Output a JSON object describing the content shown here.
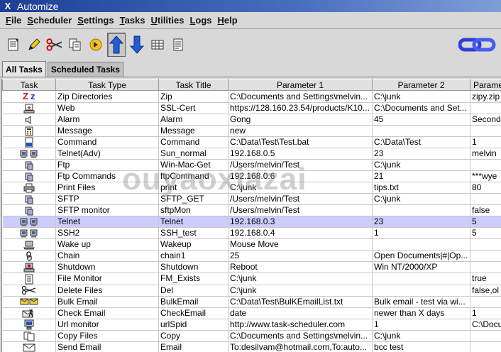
{
  "window": {
    "title": "Automize"
  },
  "menu": [
    {
      "label": "File",
      "key": "F",
      "rest": "ile"
    },
    {
      "label": "Scheduler",
      "key": "S",
      "rest": "cheduler"
    },
    {
      "label": "Settings",
      "key": "S",
      "rest": "ettings"
    },
    {
      "label": "Tasks",
      "key": "T",
      "rest": "asks"
    },
    {
      "label": "Utilities",
      "key": "U",
      "rest": "tilities"
    },
    {
      "label": "Logs",
      "key": "L",
      "rest": "ogs"
    },
    {
      "label": "Help",
      "key": "H",
      "rest": "elp"
    }
  ],
  "tabs": [
    {
      "label": "All Tasks",
      "active": true
    },
    {
      "label": "Scheduled Tasks",
      "active": false
    }
  ],
  "columns": [
    "Task",
    "Task Type",
    "Task Title",
    "Parameter 1",
    "Parameter 2",
    "Parame"
  ],
  "rows": [
    {
      "icon": "zip-icon",
      "type": "Zip Directories",
      "title": "Zip",
      "p1": "C:\\Documents and Settings\\melvin...",
      "p2": "C:\\junk",
      "p3": "zipy.zip"
    },
    {
      "icon": "web-icon",
      "type": "Web",
      "title": "SSL-Cert",
      "p1": "https://128.160.23.54/products/K10...",
      "p2": "C:\\Documents and Set...",
      "p3": ""
    },
    {
      "icon": "speaker-icon",
      "type": "Alarm",
      "title": "Alarm",
      "p1": "Gong",
      "p2": "45",
      "p3": "Second"
    },
    {
      "icon": "calculator-icon",
      "type": "Message",
      "title": "Message",
      "p1": "new",
      "p2": "",
      "p3": ""
    },
    {
      "icon": "bat-file-icon",
      "type": "Command",
      "title": "Command",
      "p1": "C:\\Data\\Test\\Test.bat",
      "p2": "C:\\Data\\Test",
      "p3": "1"
    },
    {
      "icon": "computers-icon",
      "type": "Telnet(Adv)",
      "title": "Sun_normal",
      "p1": "192.168.0.5",
      "p2": "23",
      "p3": "melvin"
    },
    {
      "icon": "ftp-icon",
      "type": "Ftp",
      "title": "Win-Mac-Get",
      "p1": "/Users/melvin/Test",
      "p2": "C:\\junk",
      "p3": ""
    },
    {
      "icon": "ftp-icon",
      "type": "Ftp Commands",
      "title": "ftpCommand",
      "p1": "192.168.0.6",
      "p2": "21",
      "p3": "***wye"
    },
    {
      "icon": "printer-icon",
      "type": "Print Files",
      "title": "print",
      "p1": "C:\\junk",
      "p2": "tips.txt",
      "p3": "80"
    },
    {
      "icon": "ftp-icon",
      "type": "SFTP",
      "title": "SFTP_GET",
      "p1": "/Users/melvin/Test",
      "p2": "C:\\junk",
      "p3": ""
    },
    {
      "icon": "ftp-icon",
      "type": "SFTP monitor",
      "title": "sftpMon",
      "p1": "/Users/melvin/Test",
      "p2": "",
      "p3": "false"
    },
    {
      "icon": "computers-icon",
      "type": "Telnet",
      "title": "Telnet",
      "p1": "192.168.0.3",
      "p2": "23",
      "p3": "5",
      "selected": true
    },
    {
      "icon": "computers-icon",
      "type": "SSH2",
      "title": "SSH_test",
      "p1": "192.168.0.4",
      "p2": "1",
      "p3": "5"
    },
    {
      "icon": "laptop-icon",
      "type": "Wake up",
      "title": "Wakeup",
      "p1": "Mouse Move",
      "p2": "",
      "p3": ""
    },
    {
      "icon": "chain-icon",
      "type": "Chain",
      "title": "chain1",
      "p1": "25",
      "p2": "Open Documents|#|Op...",
      "p3": ""
    },
    {
      "icon": "shutdown-icon",
      "type": "Shutdown",
      "title": "Shutdown",
      "p1": "Reboot",
      "p2": "Win NT/2000/XP",
      "p3": ""
    },
    {
      "icon": "document-icon",
      "type": "File Monitor",
      "title": "FM_Exists",
      "p1": "C:\\junk",
      "p2": "",
      "p3": "true"
    },
    {
      "icon": "scissors-icon",
      "type": "Delete Files",
      "title": "Del",
      "p1": "C:\\junk",
      "p2": "",
      "p3": "false,ol"
    },
    {
      "icon": "bulk-email-icon",
      "type": "Bulk Email",
      "title": "BulkEmail",
      "p1": "C:\\Data\\Test\\BulKEmailList.txt",
      "p2": "Bulk email - test via wi...",
      "p3": ""
    },
    {
      "icon": "check-email-icon",
      "type": "Check Email",
      "title": "CheckEmail",
      "p1": "date",
      "p2": "newer than X days",
      "p3": "1"
    },
    {
      "icon": "url-monitor-icon",
      "type": "Url monitor",
      "title": "urlSpid",
      "p1": "http://www.task-scheduler.com",
      "p2": "1",
      "p3": "C:\\Docu"
    },
    {
      "icon": "copy-icon",
      "type": "Copy Files",
      "title": "Copy",
      "p1": "C:\\Documents and Settings\\melvin...",
      "p2": "C:\\junk",
      "p3": ""
    },
    {
      "icon": "envelope-icon",
      "type": "Send Email",
      "title": "Email",
      "p1": "To:desilvam@hotmail.com,To:auto...",
      "p2": "bcc test",
      "p3": ""
    }
  ],
  "watermark": "ouyaoxiazai"
}
